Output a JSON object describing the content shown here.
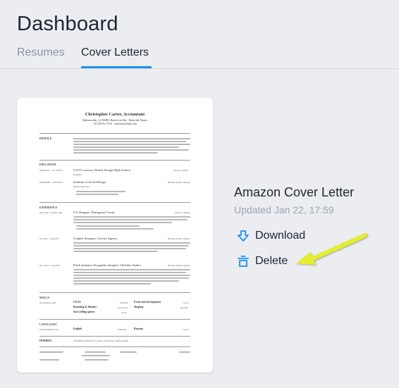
{
  "header": {
    "title": "Dashboard"
  },
  "tabs": [
    {
      "label": "Resumes"
    },
    {
      "label": "Cover Letters"
    }
  ],
  "document": {
    "name": "Amazon Cover Letter",
    "updated": "Updated Jan 22, 17:59",
    "preview": {
      "title": "Christopher Carter, Accountant",
      "contact_1": "Budenwerdsij, 16, 960805, Barrier-sin Dier - Besier-del, Russia",
      "contact_2": "+01 928 912 78 16 · chriscarter@mail.com",
      "sections": {
        "profile": "PROFILE",
        "education": "EDUCATION",
        "experience": "EXPERIENCE",
        "skills": "SKILLS",
        "languages": "LANGUAGES",
        "hobbies": "HOBBIES"
      },
      "education": [
        {
          "date": "09/09/2013 – 01/10/2013",
          "title": "UX/UI courses, British Design High School",
          "place": "Moscow, Russia",
          "sub": "Designer"
        },
        {
          "date": "09/09/2006 – 20/09/2013",
          "title": "Institute of Art & Design",
          "place": "Barrier-sin Dier, Russia",
          "sub": "Master Specialist"
        }
      ],
      "experience": [
        {
          "date": "Mar 2018 – Present time",
          "title": "UX designer, Pentagram Group",
          "place": "Moscow, Russia"
        },
        {
          "date": "Oct 2015 – Sep 2015",
          "title": "Graphic designer, Gravity Agency",
          "place": "Barrier-sin Dier, Russia"
        },
        {
          "date": "Nov 2016 – Sep 2016",
          "title": "Flash animator & graphic designer, Cheloker Studio",
          "place": "Barrier-sin Dier, Russia"
        }
      ],
      "skills": [
        {
          "a": "Archiecting order",
          "b": "UX/UI",
          "c": "Perfectly",
          "d": "Front-end development",
          "e": "Good"
        },
        {
          "a": "",
          "b": "Branding & Identity",
          "c": "Very good",
          "d": "Shaping",
          "e": "Normal"
        },
        {
          "a": "",
          "b": "Storytelling sphere",
          "c": "Good",
          "d": "",
          "e": ""
        }
      ],
      "languages": {
        "a": "Understanding order",
        "b": "English",
        "c": "Perfectly",
        "d": "Russian",
        "e": "Good"
      },
      "hobbies": "Swimming, Walking TV shows, DJ playing, Skateboarding"
    }
  },
  "actions": {
    "download": "Download",
    "delete": "Delete"
  },
  "colors": {
    "accent": "#1a91f0",
    "arrow": "#e4ee2a",
    "background": "#ebedf0"
  }
}
